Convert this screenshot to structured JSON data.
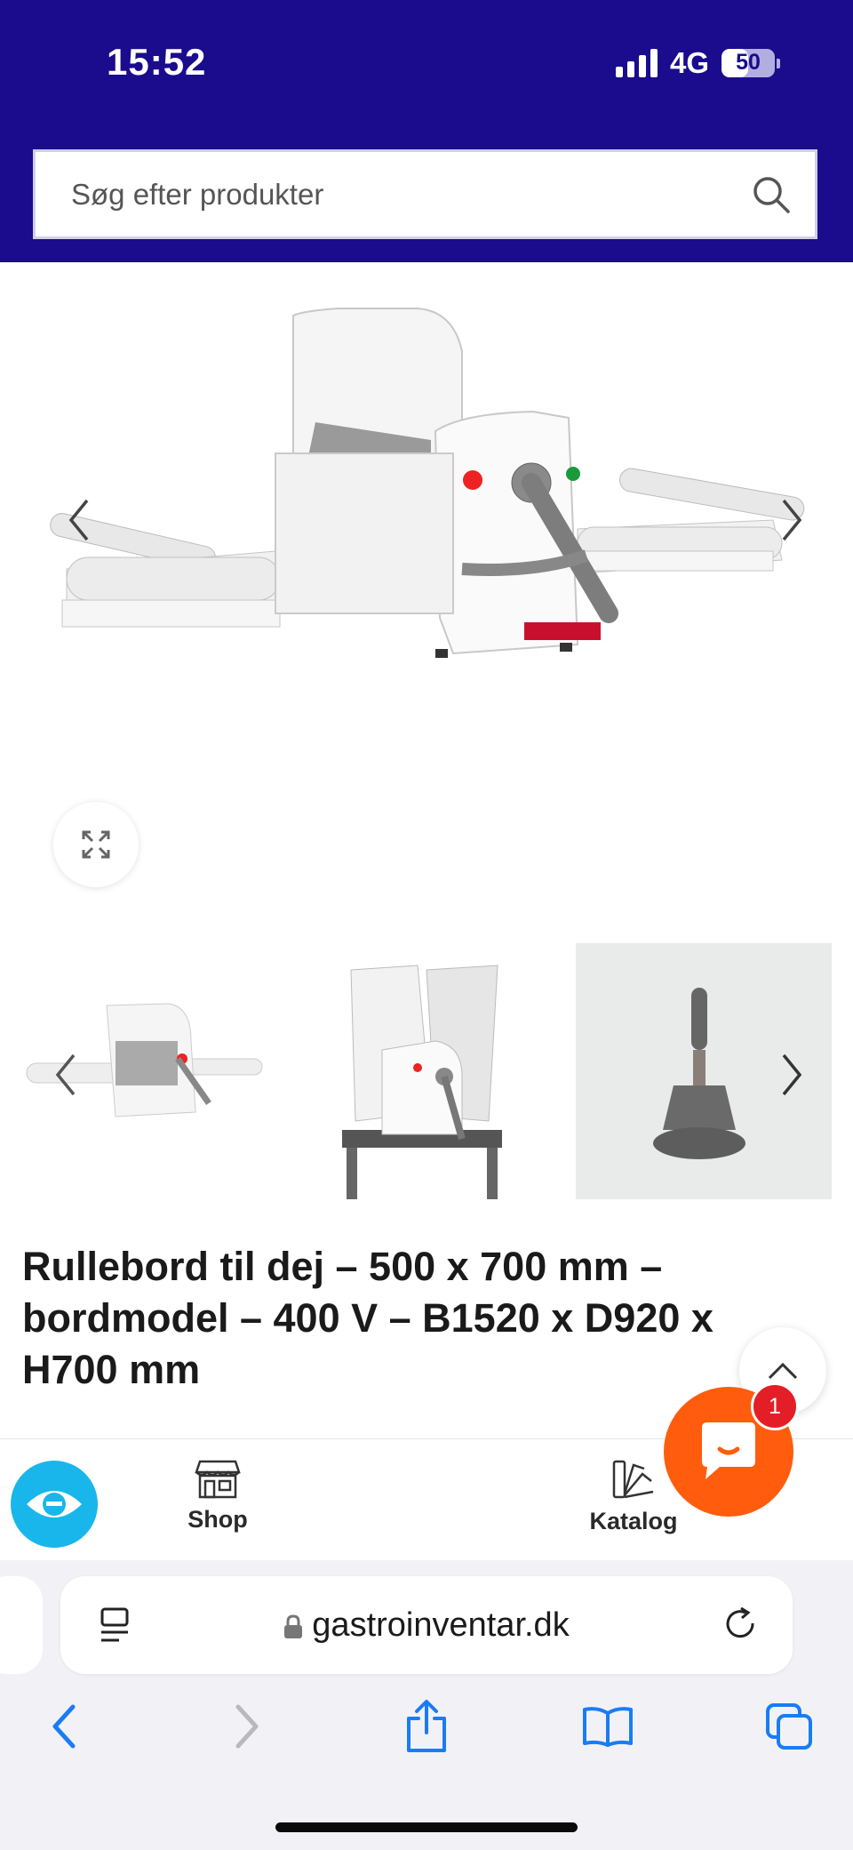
{
  "status_bar": {
    "time": "15:52",
    "network": "4G",
    "battery": "50",
    "battery_level": 0.5
  },
  "search": {
    "placeholder": "Søg efter produkter",
    "value": ""
  },
  "product": {
    "title": "Rullebord til dej – 500 x 700 mm – bordmodel – 400 V – B1520 x D920 x H700 mm",
    "thumbnail_count": 3
  },
  "bottom_nav": {
    "shop_label": "Shop",
    "catalog_label": "Katalog"
  },
  "chat": {
    "badge": "1"
  },
  "browser": {
    "url": "gastroinventar.dk"
  },
  "icons": [
    "search-icon",
    "expand-icon",
    "chevron-left-icon",
    "chevron-right-icon",
    "chevron-up-icon",
    "shop-icon",
    "catalog-icon",
    "chat-icon",
    "reader-icon",
    "lock-icon",
    "reload-icon",
    "back-icon",
    "forward-icon",
    "share-icon",
    "bookmarks-icon",
    "tabs-icon"
  ],
  "colors": {
    "header": "#1a0c8c",
    "chat": "#ff5c0e",
    "badge": "#e41e26",
    "brand": "#18b6ea",
    "ios_blue": "#1a7cf5"
  }
}
